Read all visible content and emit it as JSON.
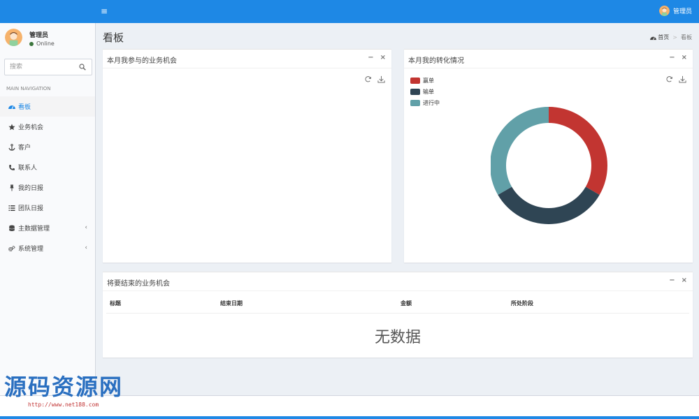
{
  "header": {
    "toggle_glyph": "≡",
    "user_name": "管理员"
  },
  "sidebar": {
    "user_name": "管理员",
    "status": "Online",
    "search_placeholder": "搜索",
    "nav_header": "MAIN NAVIGATION",
    "items": [
      {
        "label": "看板",
        "icon": "dashboard-icon",
        "active": true,
        "has_children": false
      },
      {
        "label": "业务机会",
        "icon": "star-icon",
        "active": false,
        "has_children": false
      },
      {
        "label": "客户",
        "icon": "anchor-icon",
        "active": false,
        "has_children": false
      },
      {
        "label": "联系人",
        "icon": "phone-icon",
        "active": false,
        "has_children": false
      },
      {
        "label": "我的日报",
        "icon": "thumbtack-icon",
        "active": false,
        "has_children": false
      },
      {
        "label": "团队日报",
        "icon": "list-icon",
        "active": false,
        "has_children": false
      },
      {
        "label": "主数据管理",
        "icon": "database-icon",
        "active": false,
        "has_children": true
      },
      {
        "label": "系统管理",
        "icon": "cogs-icon",
        "active": false,
        "has_children": true
      }
    ],
    "chevron_glyph": "‹"
  },
  "content": {
    "page_title": "看板",
    "breadcrumb": {
      "home": "首页",
      "separator": ">",
      "current": "看板"
    }
  },
  "boxes": {
    "opportunities_this_month": {
      "title": "本月我参与的业务机会",
      "minimize": "−",
      "close": "×"
    },
    "conversion": {
      "title": "本月我的转化情况",
      "minimize": "−",
      "close": "×"
    },
    "closing_soon": {
      "title": "将要结束的业务机会",
      "minimize": "−",
      "close": "×",
      "columns": [
        "标题",
        "结束日期",
        "金额",
        "所处阶段"
      ],
      "empty_text": "无数据"
    }
  },
  "chart_data": {
    "type": "pie",
    "categories": [
      "赢单",
      "输单",
      "进行中"
    ],
    "values": [
      1,
      1,
      1
    ],
    "colors": [
      "#c23531",
      "#2f4554",
      "#61a0a8"
    ],
    "legend_position": "top-left",
    "donut": true
  },
  "watermark": {
    "title": "源码资源网",
    "url": "http://www.net188.com"
  }
}
